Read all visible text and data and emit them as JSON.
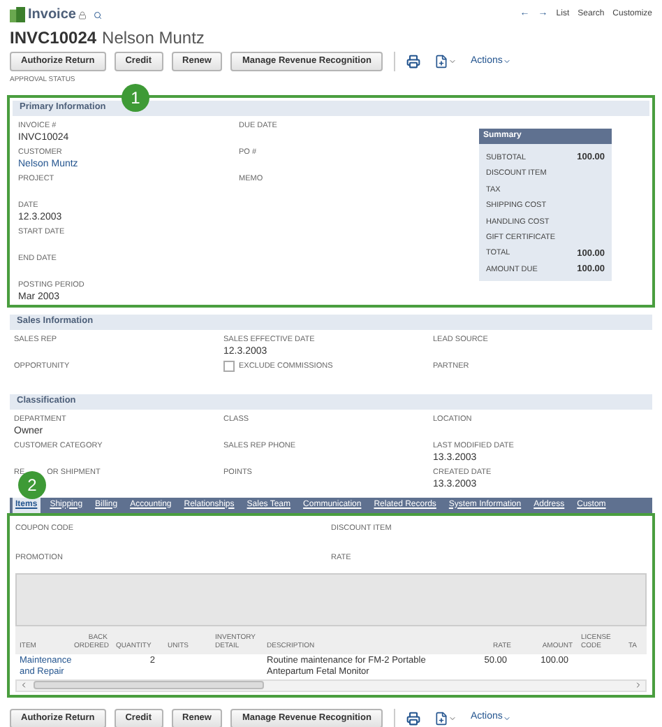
{
  "header": {
    "record_type": "Invoice",
    "nav": [
      "←",
      "→"
    ],
    "links": [
      "List",
      "Search",
      "Customize"
    ],
    "title_id": "INVC10024",
    "title_name": "Nelson Muntz"
  },
  "top_toolbar": {
    "buttons": [
      "Authorize Return",
      "Credit",
      "Renew",
      "Manage Revenue Recognition"
    ],
    "actions": "Actions"
  },
  "approval_status": "APPROVAL STATUS",
  "callouts": [
    "1",
    "2"
  ],
  "primary": {
    "title": "Primary Information",
    "column_1": [
      {
        "label": "INVOICE #",
        "value": "INVC10024",
        "kind": "text"
      },
      {
        "label": "CUSTOMER",
        "value": "Nelson Muntz",
        "kind": "link"
      },
      {
        "label": "PROJECT",
        "kind": "text"
      },
      {
        "label": "DATE",
        "value": "12.3.2003",
        "kind": "text"
      },
      {
        "label": "START DATE",
        "kind": "text"
      },
      {
        "label": "END DATE",
        "kind": "text"
      },
      {
        "label": "POSTING PERIOD",
        "value": "Mar 2003",
        "kind": "text"
      }
    ],
    "column_2": [
      {
        "label": "DUE DATE",
        "kind": "text"
      },
      {
        "label": "PO #",
        "kind": "text"
      },
      {
        "label": "MEMO",
        "kind": "text"
      }
    ],
    "summary": {
      "title": "Summary",
      "rows": [
        {
          "label": "SUBTOTAL",
          "value": "100.00"
        },
        {
          "label": "DISCOUNT ITEM"
        },
        {
          "label": "TAX"
        },
        {
          "label": "SHIPPING COST"
        },
        {
          "label": "HANDLING COST"
        },
        {
          "label": "GIFT CERTIFICATE"
        },
        {
          "label": "TOTAL",
          "value": "100.00"
        },
        {
          "label": "AMOUNT DUE",
          "value": "100.00"
        }
      ]
    }
  },
  "sales": {
    "title": "Sales Information",
    "rows": [
      [
        {
          "label": "SALES REP",
          "kind": "text"
        },
        {
          "label": "SALES EFFECTIVE DATE",
          "value": "12.3.2003",
          "kind": "text"
        },
        {
          "label": "LEAD SOURCE",
          "kind": "text"
        }
      ],
      [
        {
          "label": "OPPORTUNITY",
          "kind": "text"
        },
        {
          "label": "EXCLUDE COMMISSIONS",
          "kind": "checkbox",
          "checked": false
        },
        {
          "label": "PARTNER",
          "kind": "text"
        }
      ]
    ]
  },
  "classification": {
    "title": "Classification",
    "rows": [
      [
        {
          "label": "DEPARTMENT",
          "value": "Owner",
          "kind": "text"
        },
        {
          "label": "CLASS",
          "kind": "text"
        },
        {
          "label": "LOCATION",
          "kind": "text"
        }
      ],
      [
        {
          "label": "CUSTOMER CATEGORY",
          "kind": "text"
        },
        {
          "label": "SALES REP PHONE",
          "kind": "text"
        },
        {
          "label": "LAST MODIFIED DATE",
          "value": "13.3.2003",
          "kind": "text"
        }
      ],
      [
        {
          "label": "RE",
          "label_after": "OR SHIPMENT",
          "kind": "text"
        },
        {
          "label": "POINTS",
          "kind": "text"
        },
        {
          "label": "CREATED DATE",
          "value": "13.3.2003",
          "kind": "text"
        }
      ]
    ]
  },
  "tabs": [
    {
      "label": "Items",
      "selected": true
    },
    {
      "label": "Shipping",
      "selected": false
    },
    {
      "label": "Billing",
      "selected": false
    },
    {
      "label": "Accounting",
      "selected": false
    },
    {
      "label": "Relationships",
      "selected": false
    },
    {
      "label": "Sales Team",
      "selected": false
    },
    {
      "label": "Communication",
      "selected": false
    },
    {
      "label": "Related Records",
      "selected": false
    },
    {
      "label": "System Information",
      "selected": false
    },
    {
      "label": "Address",
      "selected": false
    },
    {
      "label": "Custom",
      "selected": false
    }
  ],
  "items_fields": [
    {
      "label": "COUPON CODE"
    },
    {
      "label": "DISCOUNT ITEM"
    },
    {
      "label": "PROMOTION"
    },
    {
      "label": "RATE"
    }
  ],
  "table": {
    "columns": [
      "ITEM",
      "BACK ORDERED",
      "QUANTITY",
      "UNITS",
      "INVENTORY DETAIL",
      "DESCRIPTION",
      "RATE",
      "AMOUNT",
      "LICENSE CODE",
      "TA"
    ],
    "rows": [
      [
        "Maintenance and Repair",
        "",
        "2",
        "",
        "",
        "Routine maintenance for FM-2 Portable Antepartum Fetal Monitor",
        "50.00",
        "100.00",
        "",
        ""
      ]
    ]
  },
  "bottom_toolbar": {
    "buttons": [
      "Authorize Return",
      "Credit",
      "Renew",
      "Manage Revenue Recognition"
    ],
    "actions": "Actions"
  }
}
